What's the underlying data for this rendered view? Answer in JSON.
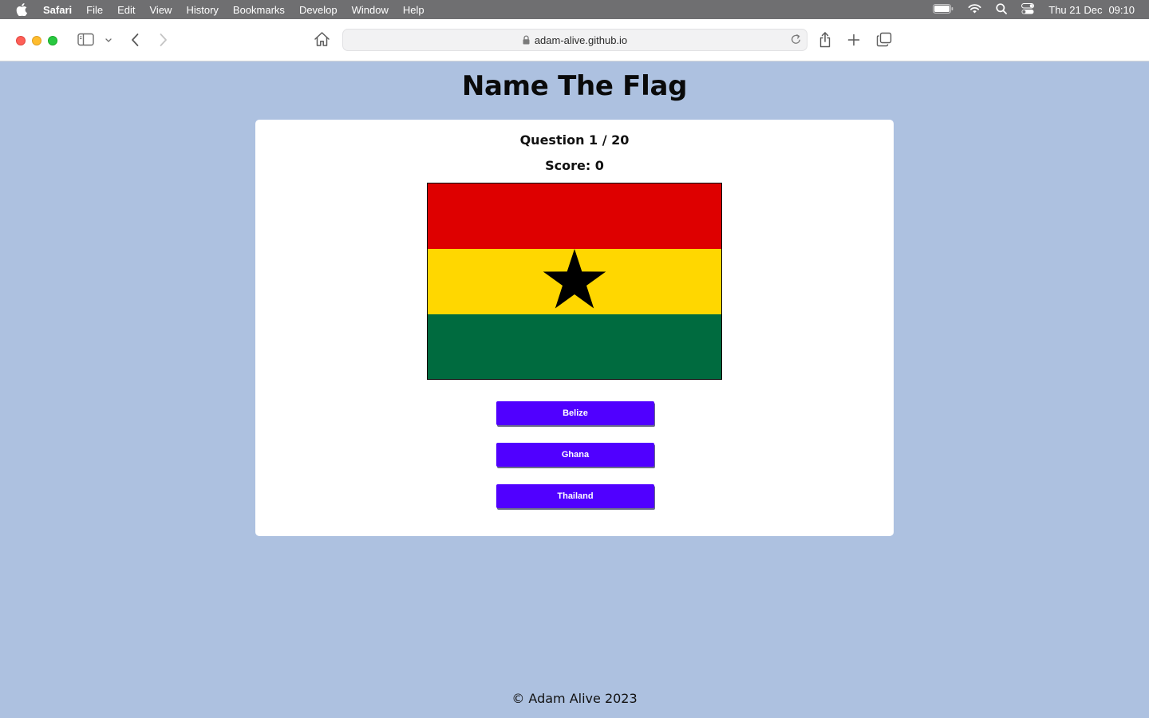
{
  "menubar": {
    "app_name": "Safari",
    "items": [
      "File",
      "Edit",
      "View",
      "History",
      "Bookmarks",
      "Develop",
      "Window",
      "Help"
    ],
    "date": "Thu 21 Dec",
    "time": "09:10"
  },
  "browser": {
    "url": "adam-alive.github.io"
  },
  "page": {
    "title": "Name The Flag",
    "question": "Question 1 / 20",
    "score": "Score: 0",
    "flag": {
      "colors": [
        "#de0000",
        "#ffd700",
        "#006b3f"
      ],
      "star_color": "#000000"
    },
    "answers": [
      "Belize",
      "Ghana",
      "Thailand"
    ],
    "answer_color": "#5000ff",
    "footer": "© Adam Alive 2023"
  },
  "colors": {
    "background": "#adc1e0",
    "card": "#ffffff"
  }
}
